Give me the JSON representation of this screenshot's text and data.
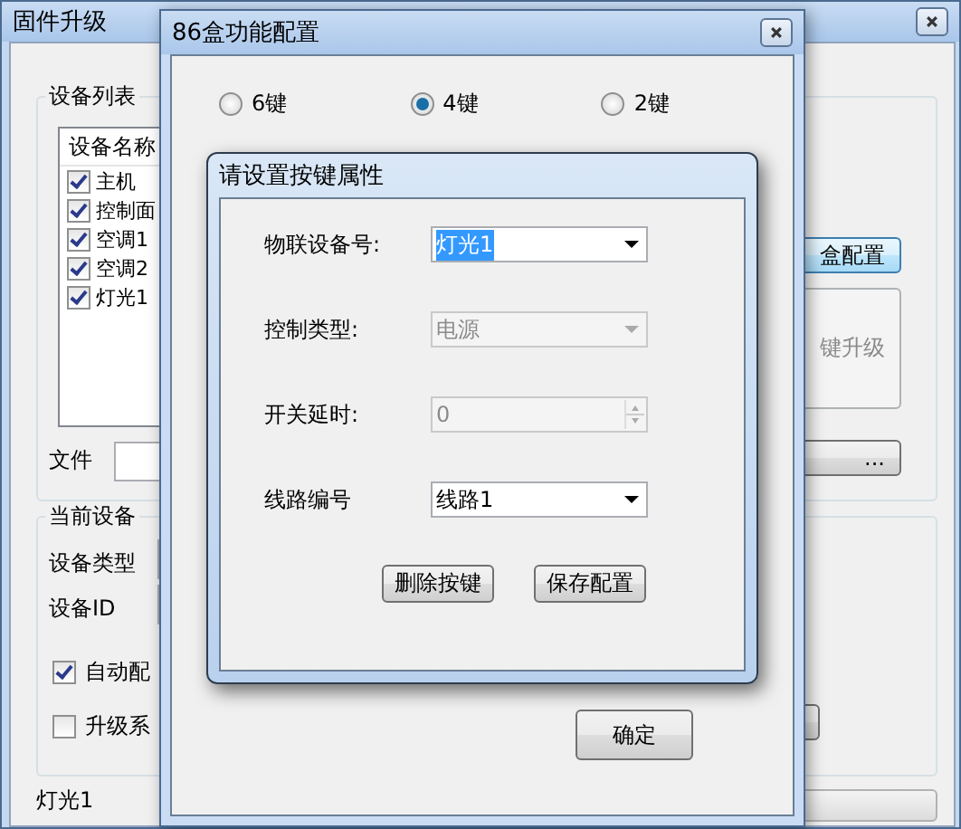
{
  "main_window": {
    "title": "固件升级",
    "device_list": {
      "title": "设备列表",
      "column": "设备名称",
      "rows": [
        {
          "name": "主机",
          "checked": true
        },
        {
          "name": "控制面",
          "checked": true
        },
        {
          "name": "空调1",
          "checked": true
        },
        {
          "name": "空调2",
          "checked": true
        },
        {
          "name": "灯光1",
          "checked": true
        }
      ]
    },
    "file_label": "文件",
    "config_button": "盒配置",
    "upgrade_button": {
      "label": "键升级",
      "disabled": true
    },
    "browse_button": "...",
    "current_device": {
      "title": "当前设备",
      "labels": [
        "设备类型",
        "设备ID"
      ],
      "options": [
        {
          "label": "自动配",
          "checked": true
        },
        {
          "label": "升级系",
          "checked": false
        }
      ]
    },
    "status": "灯光1",
    "progress": {
      "level": 0
    }
  },
  "config_dialog": {
    "title": "86盒功能配置",
    "radios": [
      {
        "label": "6键",
        "selected": false
      },
      {
        "label": "4键",
        "selected": true
      },
      {
        "label": "2键",
        "selected": false
      }
    ],
    "ok_button": "确定"
  },
  "key_dialog": {
    "title": "请设置按键属性",
    "fields": [
      {
        "kind": "combo",
        "label": "物联设备号:",
        "value": "灯光1",
        "disabled": false,
        "text_selected": true
      },
      {
        "kind": "combo",
        "label": "控制类型:",
        "value": "电源",
        "disabled": true,
        "text_selected": false
      },
      {
        "kind": "spin",
        "label": "开关延时:",
        "value": "0",
        "disabled": true,
        "text_selected": false
      },
      {
        "kind": "combo",
        "label": "线路编号",
        "value": "线路1",
        "disabled": false,
        "text_selected": false
      }
    ],
    "buttons": [
      "删除按键",
      "保存配置"
    ]
  }
}
